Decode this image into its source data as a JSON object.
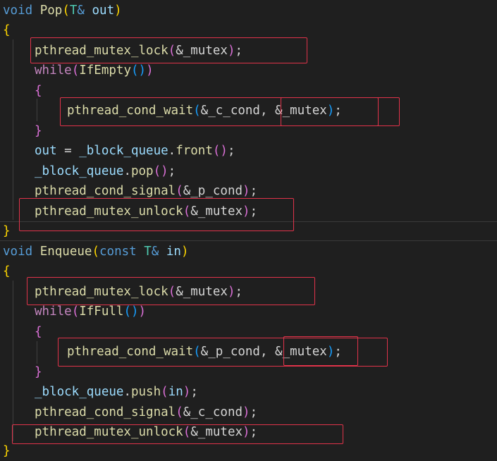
{
  "code": {
    "pop_sig": {
      "kw": "void",
      "name": "Pop",
      "open": "(",
      "type": "T",
      "amp": "&",
      "param": "out",
      "close": ")"
    },
    "pop_open": "{",
    "pop_lock": {
      "fn": "pthread_mutex_lock",
      "open": "(",
      "arg": "&_mutex",
      "close": ")",
      "semi": ";"
    },
    "pop_while": {
      "kw": "while",
      "open": "(",
      "fn": "IfEmpty",
      "call": "()",
      "close": ")"
    },
    "pop_inner_open": "{",
    "pop_wait": {
      "fn": "pthread_cond_wait",
      "open": "(",
      "arg": "&_c_cond",
      "comma": ",",
      "arg2": " &_mutex",
      "close": ")",
      "semi": ";"
    },
    "pop_inner_close": "}",
    "pop_front": {
      "var": "out",
      "eq": " = ",
      "obj": "_block_queue",
      "dot": ".",
      "fn": "front",
      "call": "()",
      "semi": ";"
    },
    "pop_pop": {
      "obj": "_block_queue",
      "dot": ".",
      "fn": "pop",
      "call": "()",
      "semi": ";"
    },
    "pop_signal": {
      "fn": "pthread_cond_signal",
      "open": "(",
      "arg": "&_p_cond",
      "close": ")",
      "semi": ";"
    },
    "pop_unlock": {
      "fn": "pthread_mutex_unlock",
      "open": "(",
      "arg": "&_mutex",
      "close": ")",
      "semi": ";"
    },
    "pop_close": "}",
    "enq_sig": {
      "kw": "void",
      "name": "Enqueue",
      "open": "(",
      "const": "const",
      "type": "T",
      "amp": "&",
      "param": "in",
      "close": ")"
    },
    "enq_open": "{",
    "enq_lock": {
      "fn": "pthread_mutex_lock",
      "open": "(",
      "arg": "&_mutex",
      "close": ")",
      "semi": ";"
    },
    "enq_while": {
      "kw": "while",
      "open": "(",
      "fn": "IfFull",
      "call": "()",
      "close": ")"
    },
    "enq_inner_open": "{",
    "enq_wait": {
      "fn": "pthread_cond_wait",
      "open": "(",
      "arg": "&_p_cond",
      "comma": ",",
      "arg2": " &_mutex",
      "close": ")",
      "semi": ";"
    },
    "enq_inner_close": "}",
    "enq_push": {
      "obj": "_block_queue",
      "dot": ".",
      "fn": "push",
      "open": "(",
      "arg": "in",
      "close": ")",
      "semi": ";"
    },
    "enq_signal": {
      "fn": "pthread_cond_signal",
      "open": "(",
      "arg": "&_c_cond",
      "close": ")",
      "semi": ";"
    },
    "enq_unlock": {
      "fn": "pthread_mutex_unlock",
      "open": "(",
      "arg": "&_mutex",
      "close": ")",
      "semi": ";"
    },
    "enq_close": "}"
  },
  "colors": {
    "background": "#1f1f1f",
    "keyword": "#569cd6",
    "control": "#c586c0",
    "function": "#dcdcaa",
    "type": "#4ec9b0",
    "variable": "#9cdcfe",
    "highlight_box": "#e0334a"
  }
}
